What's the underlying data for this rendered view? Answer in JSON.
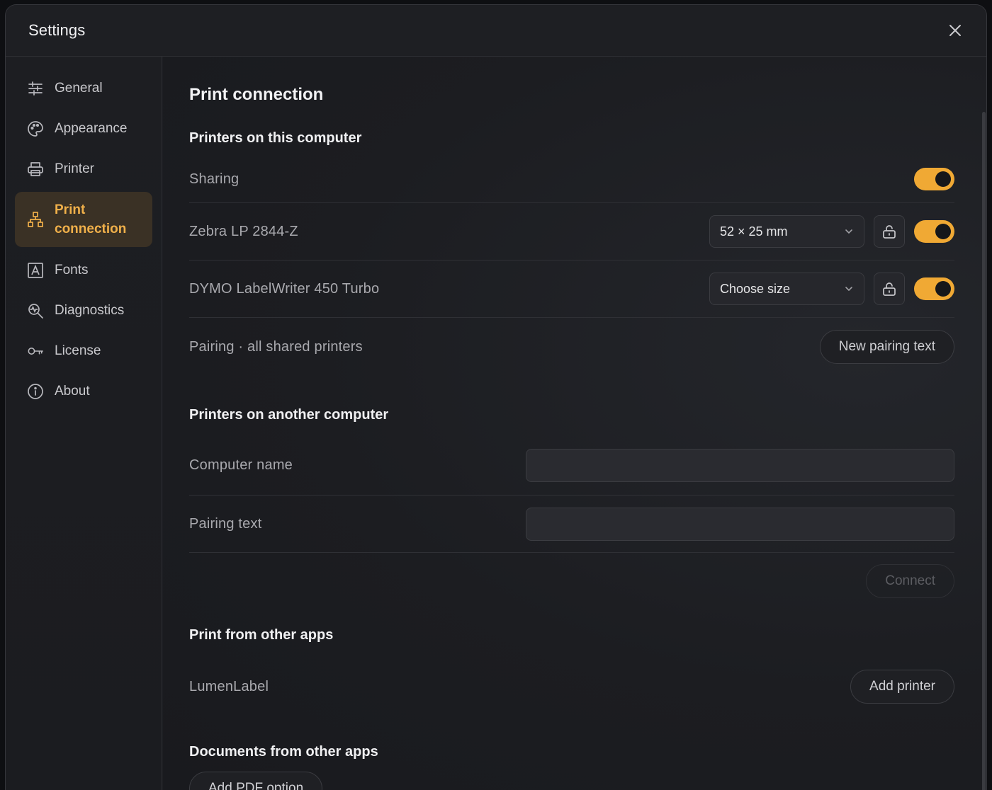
{
  "window": {
    "title": "Settings"
  },
  "sidebar": {
    "items": [
      {
        "label": "General",
        "icon": "sliders-icon"
      },
      {
        "label": "Appearance",
        "icon": "palette-icon"
      },
      {
        "label": "Printer",
        "icon": "printer-icon"
      },
      {
        "label": "Print\nconnection",
        "icon": "network-icon",
        "active": true
      },
      {
        "label": "Fonts",
        "icon": "font-icon"
      },
      {
        "label": "Diagnostics",
        "icon": "diagnostics-icon"
      },
      {
        "label": "License",
        "icon": "key-icon"
      },
      {
        "label": "About",
        "icon": "info-icon"
      }
    ]
  },
  "main": {
    "title": "Print connection",
    "local": {
      "heading": "Printers on this computer",
      "sharing_label": "Sharing",
      "sharing_on": true,
      "printers": [
        {
          "name": "Zebra LP 2844-Z",
          "size": "52 × 25 mm",
          "enabled": true
        },
        {
          "name": "DYMO LabelWriter 450 Turbo",
          "size": "Choose size",
          "enabled": true
        }
      ],
      "pairing_label": "Pairing · all shared printers",
      "pairing_button": "New pairing text"
    },
    "remote": {
      "heading": "Printers on another computer",
      "computer_name_label": "Computer name",
      "computer_name_value": "",
      "pairing_text_label": "Pairing text",
      "pairing_text_value": "",
      "connect_button": "Connect"
    },
    "other_apps": {
      "heading": "Print from other apps",
      "app_label": "LumenLabel",
      "add_printer_button": "Add printer"
    },
    "documents": {
      "heading": "Documents from other apps",
      "partial_button": "Add PDF option"
    }
  },
  "colors": {
    "accent": "#f0a934",
    "background": "#1c1d21",
    "active_nav_bg": "#3a3125"
  }
}
